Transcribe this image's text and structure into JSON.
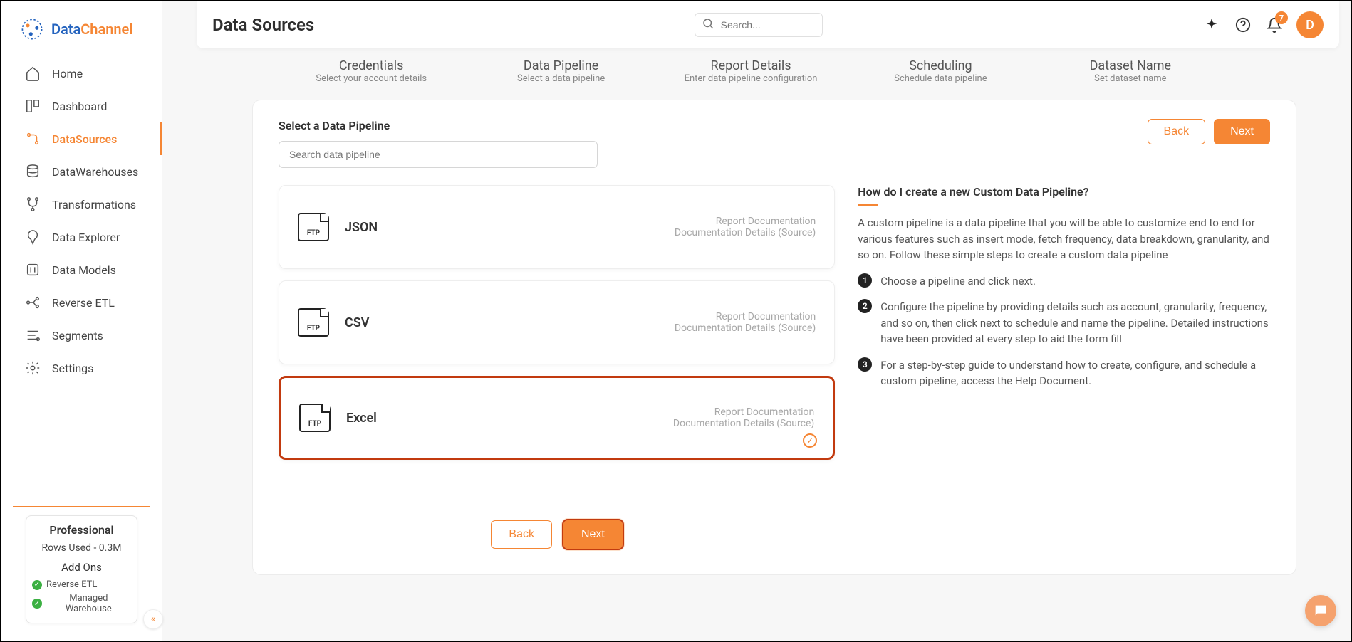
{
  "brand": {
    "part1": "Data",
    "part2": "Channel"
  },
  "sidebar": {
    "items": [
      {
        "label": "Home"
      },
      {
        "label": "Dashboard"
      },
      {
        "label": "DataSources"
      },
      {
        "label": "DataWarehouses"
      },
      {
        "label": "Transformations"
      },
      {
        "label": "Data Explorer"
      },
      {
        "label": "Data Models"
      },
      {
        "label": "Reverse ETL"
      },
      {
        "label": "Segments"
      },
      {
        "label": "Settings"
      }
    ],
    "plan": {
      "title": "Professional",
      "rows": "Rows Used - 0.3M",
      "addons_title": "Add Ons",
      "addon1": "Reverse ETL",
      "addon2": "Managed Warehouse"
    }
  },
  "header": {
    "title": "Data Sources",
    "search_placeholder": "Search...",
    "notif_count": "7",
    "avatar": "D"
  },
  "stepper": [
    {
      "title": "Credentials",
      "desc": "Select your account details"
    },
    {
      "title": "Data Pipeline",
      "desc": "Select a data pipeline"
    },
    {
      "title": "Report Details",
      "desc": "Enter data pipeline configuration"
    },
    {
      "title": "Scheduling",
      "desc": "Schedule data pipeline"
    },
    {
      "title": "Dataset Name",
      "desc": "Set dataset name"
    }
  ],
  "card": {
    "select_label": "Select a Data Pipeline",
    "search_placeholder": "Search data pipeline",
    "back": "Back",
    "next": "Next",
    "pipeline_icon_label": "FTP",
    "pipelines": [
      {
        "name": "JSON",
        "l1": "Report Documentation",
        "l2": "Documentation Details (Source)",
        "selected": false
      },
      {
        "name": "CSV",
        "l1": "Report Documentation",
        "l2": "Documentation Details (Source)",
        "selected": false
      },
      {
        "name": "Excel",
        "l1": "Report Documentation",
        "l2": "Documentation Details (Source)",
        "selected": true
      }
    ]
  },
  "help": {
    "title": "How do I create a new Custom Data Pipeline?",
    "para": "A custom pipeline is a data pipeline that you will be able to customize end to end for various features such as insert mode, fetch frequency, data breakdown, granularity, and so on. Follow these simple steps to create a custom data pipeline",
    "steps": [
      "Choose a pipeline and click next.",
      "Configure the pipeline by providing details such as account, granularity, frequency, and so on, then click next to schedule and name the pipeline. Detailed instructions have been provided at every step to aid the form fill",
      "For a step-by-step guide to understand how to create, configure, and schedule a custom pipeline, access the Help Document."
    ],
    "nums": [
      "1",
      "2",
      "3"
    ]
  }
}
